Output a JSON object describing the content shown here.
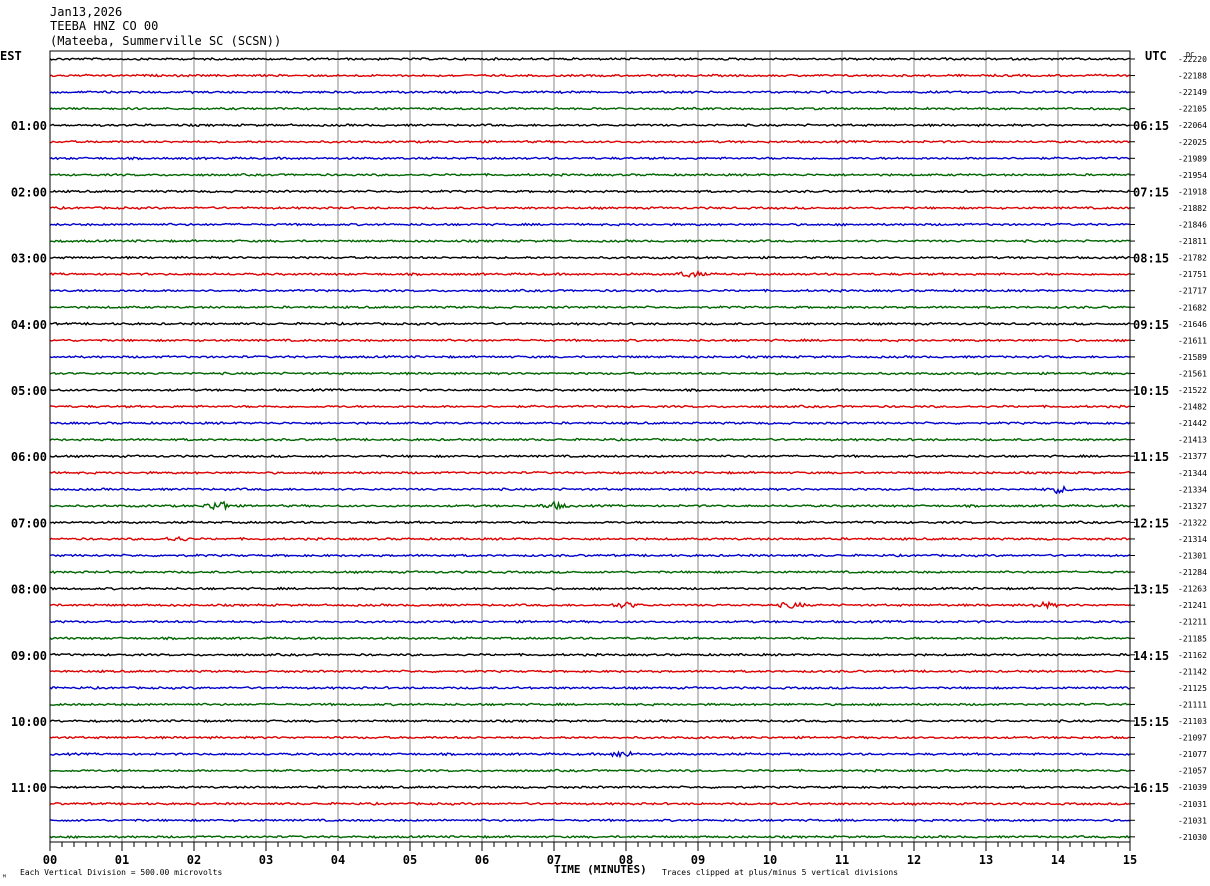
{
  "header": {
    "date": "Jan13,2026",
    "station": "TEEBA HNZ CO 00",
    "location": "(Mateeba, Summerville SC (SCSN))"
  },
  "left_timezone": "EST",
  "right_timezone": "UTC",
  "dc_label": "DC",
  "footer": {
    "vertical_division": "Each Vertical Division =  500.00 microvolts",
    "clip_note": "Traces clipped at plus/minus 5 vertical divisions",
    "corner_mark": "ᴹ"
  },
  "chart_data": {
    "type": "line",
    "title": "TEEBA HNZ CO 00",
    "xlabel": "TIME (MINUTES)",
    "x_ticks": [
      "00",
      "01",
      "02",
      "03",
      "04",
      "05",
      "06",
      "07",
      "08",
      "09",
      "10",
      "11",
      "12",
      "13",
      "14",
      "15"
    ],
    "xlim": [
      0,
      15
    ],
    "trace_colors": [
      "#000000",
      "#dd0000",
      "#0000cc",
      "#006600"
    ],
    "left_hour_labels": [
      "01:00",
      "02:00",
      "03:00",
      "04:00",
      "05:00",
      "06:00",
      "07:00",
      "08:00",
      "09:00",
      "10:00",
      "11:00"
    ],
    "right_hour_labels": [
      "06:15",
      "07:15",
      "08:15",
      "09:15",
      "10:15",
      "11:15",
      "12:15",
      "13:15",
      "14:15",
      "15:15",
      "16:15"
    ],
    "dc_offsets": [
      "-22220",
      "-22188",
      "-22149",
      "-22105",
      "-22064",
      "-22025",
      "-21989",
      "-21954",
      "-21918",
      "-21882",
      "-21846",
      "-21811",
      "-21782",
      "-21751",
      "-21717",
      "-21682",
      "-21646",
      "-21611",
      "-21589",
      "-21561",
      "-21522",
      "-21482",
      "-21442",
      "-21413",
      "-21377",
      "-21344",
      "-21334",
      "-21327",
      "-21322",
      "-21314",
      "-21301",
      "-21284",
      "-21263",
      "-21241",
      "-21211",
      "-21185",
      "-21162",
      "-21142",
      "-21125",
      "-21111",
      "-21103",
      "-21097",
      "-21077",
      "-21057",
      "-21039",
      "-21031",
      "-21031",
      "-21030"
    ],
    "events": [
      {
        "trace": 27,
        "minute": 2.35,
        "amplitude": 0.5
      },
      {
        "trace": 27,
        "minute": 7.0,
        "amplitude": 0.3
      },
      {
        "trace": 26,
        "minute": 14.0,
        "amplitude": 0.3
      },
      {
        "trace": 13,
        "minute": 8.9,
        "amplitude": 0.3
      },
      {
        "trace": 42,
        "minute": 7.95,
        "amplitude": 0.3
      },
      {
        "trace": 29,
        "minute": 1.75,
        "amplitude": 0.2
      },
      {
        "trace": 33,
        "minute": 8.0,
        "amplitude": 0.25
      },
      {
        "trace": 33,
        "minute": 10.3,
        "amplitude": 0.25
      },
      {
        "trace": 33,
        "minute": 13.8,
        "amplitude": 0.25
      }
    ]
  }
}
